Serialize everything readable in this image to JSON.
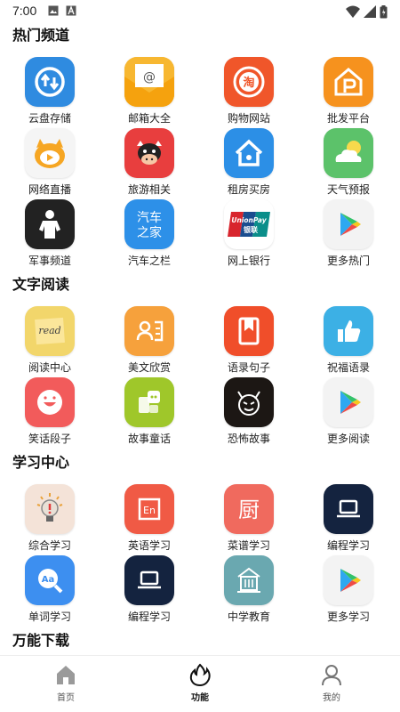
{
  "status_bar": {
    "time": "7:00",
    "icons": [
      "image-icon",
      "font-icon",
      "wifi-icon",
      "signal-icon",
      "battery-icon"
    ]
  },
  "sections": [
    {
      "title": "热门频道",
      "items": [
        {
          "label": "云盘存储",
          "icon": "cloud-sync-icon",
          "color": "#2f8be0"
        },
        {
          "label": "邮箱大全",
          "icon": "mail-icon",
          "color": "#f7b731"
        },
        {
          "label": "购物网站",
          "icon": "taobao-icon",
          "color": "#f0562a"
        },
        {
          "label": "批发平台",
          "icon": "warehouse-icon",
          "color": "#f6921e"
        },
        {
          "label": "网络直播",
          "icon": "live-mascot-icon",
          "color": "#f5f5f5"
        },
        {
          "label": "旅游相关",
          "icon": "cow-mascot-icon",
          "color": "#e83e3e"
        },
        {
          "label": "租房买房",
          "icon": "house-icon",
          "color": "#2c8fe6"
        },
        {
          "label": "天气预报",
          "icon": "weather-icon",
          "color": "#5cc26a"
        },
        {
          "label": "军事频道",
          "icon": "soldier-icon",
          "color": "#222222"
        },
        {
          "label": "汽车之栏",
          "icon": "car-home-icon",
          "color": "#2d90e8",
          "tile_text": [
            "汽车",
            "之家"
          ]
        },
        {
          "label": "网上银行",
          "icon": "unionpay-icon",
          "color": "#ffffff",
          "tile_text": [
            "UnionPay",
            "银联"
          ]
        },
        {
          "label": "更多热门",
          "icon": "play-store-icon",
          "color": "#f3f3f3"
        }
      ]
    },
    {
      "title": "文字阅读",
      "items": [
        {
          "label": "阅读中心",
          "icon": "read-note-icon",
          "color": "#f2d66b",
          "tile_text": [
            "read"
          ]
        },
        {
          "label": "美文欣赏",
          "icon": "profile-card-icon",
          "color": "#f6a13c"
        },
        {
          "label": "语录句子",
          "icon": "bookmark-icon",
          "color": "#f04e2a"
        },
        {
          "label": "祝福语录",
          "icon": "thumbs-up-icon",
          "color": "#3cb0e5"
        },
        {
          "label": "笑话段子",
          "icon": "smile-icon",
          "color": "#f25b5b"
        },
        {
          "label": "故事童话",
          "icon": "story-icon",
          "color": "#9fc72a"
        },
        {
          "label": "恐怖故事",
          "icon": "devil-icon",
          "color": "#1c1714"
        },
        {
          "label": "更多阅读",
          "icon": "play-store-icon",
          "color": "#f3f3f3"
        }
      ]
    },
    {
      "title": "学习中心",
      "items": [
        {
          "label": "综合学习",
          "icon": "bulb-icon",
          "color": "#f4e3d8"
        },
        {
          "label": "英语学习",
          "icon": "english-icon",
          "color": "#f05a45",
          "tile_text": [
            "En"
          ]
        },
        {
          "label": "菜谱学习",
          "icon": "kitchen-icon",
          "color": "#f06a5e",
          "tile_text": [
            "厨"
          ]
        },
        {
          "label": "编程学习",
          "icon": "laptop-icon",
          "color": "#14233f"
        },
        {
          "label": "单词学习",
          "icon": "dictionary-search-icon",
          "color": "#3d8ff0",
          "tile_text": [
            "Aa"
          ]
        },
        {
          "label": "编程学习",
          "icon": "laptop-icon",
          "color": "#14233f"
        },
        {
          "label": "中学教育",
          "icon": "school-icon",
          "color": "#6aa8b0"
        },
        {
          "label": "更多学习",
          "icon": "play-store-icon",
          "color": "#f3f3f3"
        }
      ]
    },
    {
      "title": "万能下载",
      "items": []
    }
  ],
  "bottom_nav": [
    {
      "label": "首页",
      "icon": "home-icon",
      "active": false
    },
    {
      "label": "功能",
      "icon": "flame-icon",
      "active": true
    },
    {
      "label": "我的",
      "icon": "user-icon",
      "active": false
    }
  ]
}
